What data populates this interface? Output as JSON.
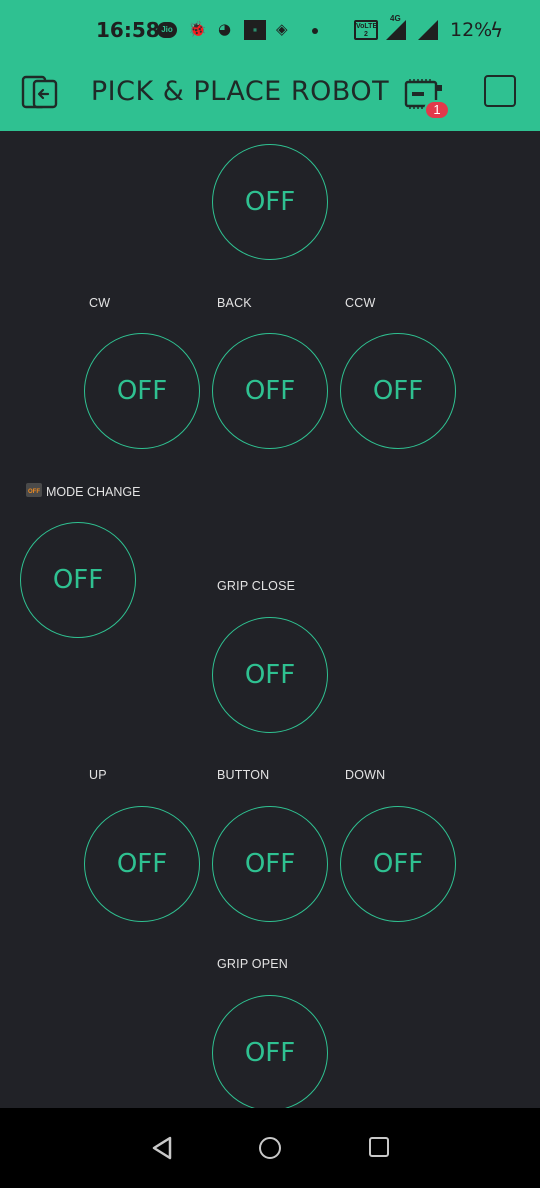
{
  "status_bar": {
    "time": "16:58",
    "network": "4G",
    "volte": "VoLTE 2",
    "battery": "12%",
    "icons": [
      "jio-icon",
      "bug-icon",
      "pacman-icon",
      "box-icon",
      "gamepad-icon",
      "dot-icon"
    ]
  },
  "header": {
    "title": "PICK & PLACE ROBOT",
    "badge_count": "1"
  },
  "widgets": {
    "top": {
      "value": "OFF"
    },
    "cw": {
      "label": "CW",
      "value": "OFF"
    },
    "back": {
      "label": "BACK",
      "value": "OFF"
    },
    "ccw": {
      "label": "CCW",
      "value": "OFF"
    },
    "mode_change": {
      "label": "MODE CHANGE",
      "toggle_text": "OFF",
      "value": "OFF"
    },
    "grip_close": {
      "label": "GRIP CLOSE",
      "value": "OFF"
    },
    "up": {
      "label": "UP",
      "value": "OFF"
    },
    "button": {
      "label": "BUTTON",
      "value": "OFF"
    },
    "down": {
      "label": "DOWN",
      "value": "OFF"
    },
    "grip_open": {
      "label": "GRIP OPEN",
      "value": "OFF"
    }
  },
  "colors": {
    "accent": "#2fc191",
    "background": "#212227",
    "badge": "#e2394b",
    "text": "#e3e3e3"
  }
}
